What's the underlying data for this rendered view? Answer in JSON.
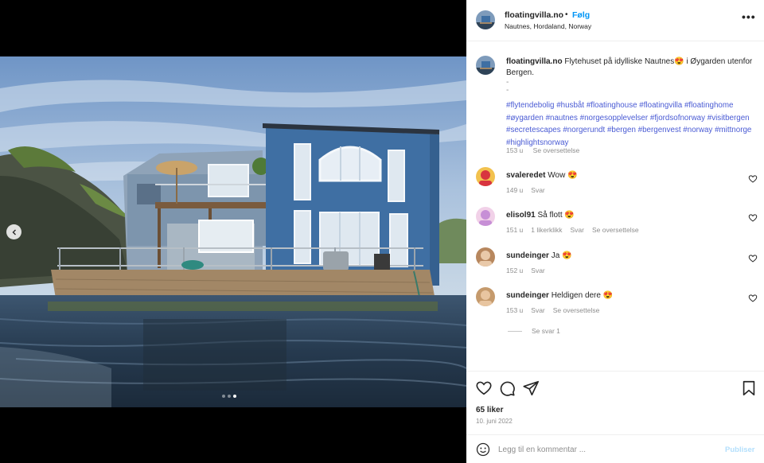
{
  "post": {
    "username": "floatingvilla.no",
    "separator": "•",
    "follow_label": "Følg",
    "location": "Nautnes, Hordaland, Norway",
    "more_label": "•••"
  },
  "caption": {
    "username": "floatingvilla.no",
    "text_part1": "Flytehuset på idylliske Nautnes",
    "emoji": "😍",
    "text_part2": " i Øygarden utenfor Bergen.",
    "dash1": "-",
    "dash2": "-",
    "hashtags": [
      "#flytendebolig",
      "#husbåt",
      "#floatinghouse",
      "#floatingvilla",
      "#floatinghome",
      "#øygarden",
      "#nautnes",
      "#norgesopplevelser",
      "#fjordsofnorway",
      "#visitbergen",
      "#secretescapes",
      "#norgerundt",
      "#bergen",
      "#bergenvest",
      "#norway",
      "#mittnorge",
      "#highlightsnorway"
    ],
    "time": "153 u",
    "translate_label": "Se oversettelse"
  },
  "comments": [
    {
      "user": "svaleredet",
      "text": "Wow",
      "emoji": "😍",
      "time": "149 u",
      "likes": "",
      "reply_label": "Svar",
      "translate_label": ""
    },
    {
      "user": "elisol91",
      "text": "Så flott",
      "emoji": "😍",
      "time": "151 u",
      "likes": "1 likerklikk",
      "reply_label": "Svar",
      "translate_label": "Se oversettelse"
    },
    {
      "user": "sundeinger",
      "text": "Ja",
      "emoji": "😍",
      "time": "152 u",
      "likes": "",
      "reply_label": "Svar",
      "translate_label": ""
    },
    {
      "user": "sundeinger",
      "text": "Heldigen dere",
      "emoji": "😍",
      "time": "153 u",
      "likes": "",
      "reply_label": "Svar",
      "translate_label": "Se oversettelse"
    }
  ],
  "view_replies_label": "Se svar 1",
  "likes_count": "65 liker",
  "date": "10. juni 2022",
  "comment_box": {
    "placeholder": "Legg til en kommentar ...",
    "publish_label": "Publiser"
  },
  "carousel": {
    "slide_count": 3,
    "active_index": 2
  },
  "colors": {
    "accent": "#0095f6",
    "hashtag": "#4a5bd4",
    "house": "#3f6fa3"
  }
}
